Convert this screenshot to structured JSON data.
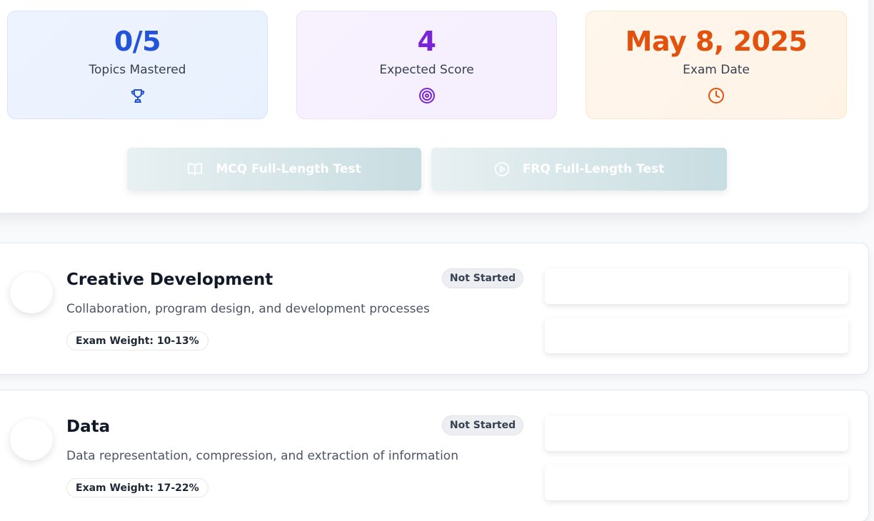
{
  "stats": [
    {
      "value": "0/5",
      "label": "Topics Mastered",
      "icon": "trophy-icon",
      "color": "#2353db"
    },
    {
      "value": "4",
      "label": "Expected Score",
      "icon": "target-icon",
      "color": "#7a24d9"
    },
    {
      "value": "May 8, 2025",
      "label": "Exam Date",
      "icon": "clock-icon",
      "color": "#e2520d"
    }
  ],
  "actions": {
    "mcq_label": "MCQ Full-Length Test",
    "frq_label": "FRQ Full-Length Test"
  },
  "units": [
    {
      "title": "Creative Development",
      "description": "Collaboration, program design, and development processes",
      "weight": "Exam Weight: 10-13%",
      "status": "Not Started"
    },
    {
      "title": "Data",
      "description": "Data representation, compression, and extraction of information",
      "weight": "Exam Weight: 17-22%",
      "status": "Not Started"
    }
  ]
}
